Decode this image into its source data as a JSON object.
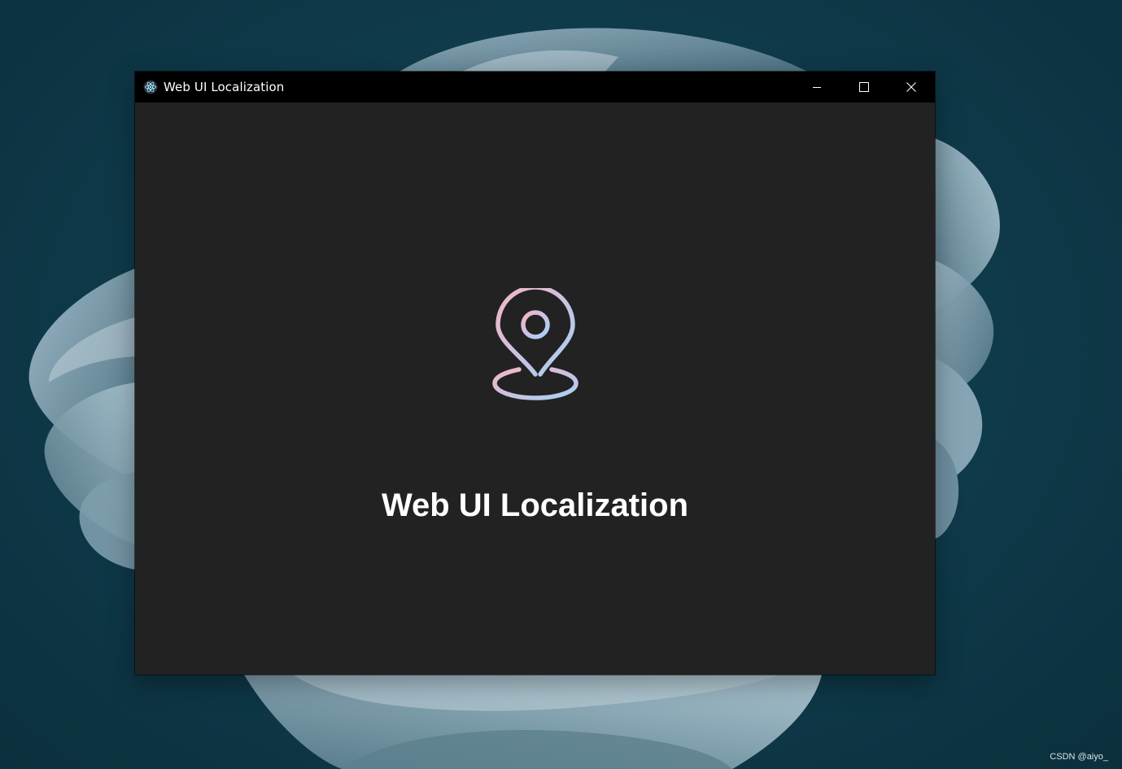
{
  "window": {
    "title": "Web UI Localization",
    "app_icon": "electron-icon",
    "caption_buttons": {
      "minimize_icon": "minimize-icon",
      "maximize_icon": "maximize-icon",
      "close_icon": "close-icon"
    }
  },
  "content": {
    "icon": "location-pin-icon",
    "heading": "Web UI Localization"
  },
  "watermark": "CSDN @aiyo_",
  "colors": {
    "desktop_bg": "#0e3a4b",
    "window_bg": "#222222",
    "titlebar_bg": "#000000",
    "pin_gradient_start": "#f0b8c8",
    "pin_gradient_end": "#a8d4f4"
  }
}
